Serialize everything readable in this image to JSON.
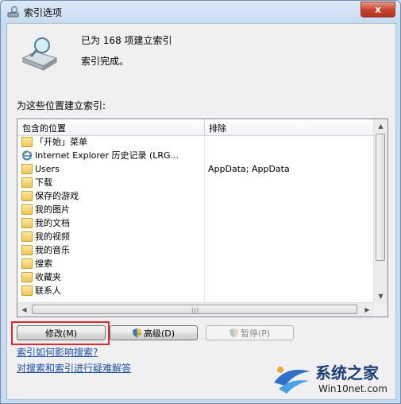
{
  "window": {
    "title": "索引选项",
    "close_label": "x"
  },
  "status": {
    "count_text": "已为 168 项建立索引",
    "done_text": "索引完成。"
  },
  "section_label": "为这些位置建立索引:",
  "list": {
    "columns": {
      "included": "包含的位置",
      "excluded": "排除"
    },
    "rows": [
      {
        "name": "「开始」菜单",
        "exclude": "",
        "icon": "folder-icon"
      },
      {
        "name": "Internet Explorer 历史记录 (LRG...",
        "exclude": "",
        "icon": "ie-icon"
      },
      {
        "name": "Users",
        "exclude": "AppData; AppData",
        "icon": "folder-icon"
      },
      {
        "name": "下载",
        "exclude": "",
        "icon": "download-folder-icon"
      },
      {
        "name": "保存的游戏",
        "exclude": "",
        "icon": "games-folder-icon"
      },
      {
        "name": "我的图片",
        "exclude": "",
        "icon": "pictures-folder-icon"
      },
      {
        "name": "我的文档",
        "exclude": "",
        "icon": "documents-folder-icon"
      },
      {
        "name": "我的视频",
        "exclude": "",
        "icon": "videos-folder-icon"
      },
      {
        "name": "我的音乐",
        "exclude": "",
        "icon": "music-folder-icon"
      },
      {
        "name": "搜索",
        "exclude": "",
        "icon": "searches-folder-icon"
      },
      {
        "name": "收藏夹",
        "exclude": "",
        "icon": "favorites-folder-icon"
      },
      {
        "name": "联系人",
        "exclude": "",
        "icon": "contacts-folder-icon"
      }
    ]
  },
  "buttons": {
    "modify": "修改(M)",
    "advanced": "高级(D)",
    "pause": "暂停(P)"
  },
  "links": {
    "how_affects": "索引如何影响搜索?",
    "troubleshoot": "对搜索和索引进行疑难解答"
  },
  "watermark": {
    "brand": "系统之家",
    "site": "Win10net.com"
  },
  "colors": {
    "highlight": "#e1262e",
    "link": "#1a4fb3",
    "titlebar": "#c8dbef"
  }
}
